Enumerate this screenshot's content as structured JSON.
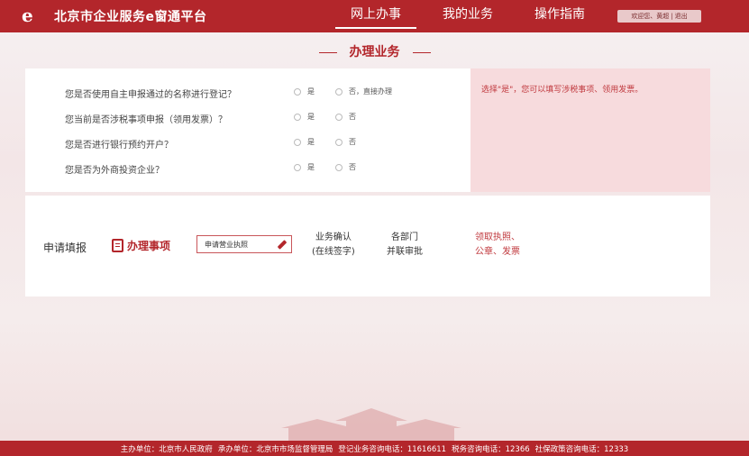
{
  "header": {
    "site_title": "北京市企业服务e窗通平台",
    "nav": [
      "网上办事",
      "我的业务",
      "操作指南"
    ],
    "user": {
      "welcome": "欢迎您、黄超",
      "sep": "|",
      "logout": "退出"
    }
  },
  "section_title": "办理业务",
  "questions": [
    {
      "text": "您是否使用自主申报通过的名称进行登记？",
      "opt_yes": "是",
      "opt_no": "否，直接办理"
    },
    {
      "text": "您当前是否涉税事项申报（领用发票）？",
      "opt_yes": "是",
      "opt_no": "否"
    },
    {
      "text": "您是否进行银行预约开户？",
      "opt_yes": "是",
      "opt_no": "否"
    },
    {
      "text": "您是否为外商投资企业？",
      "opt_yes": "是",
      "opt_no": "否"
    }
  ],
  "info_text": "选择\"是\"，您可以填写涉税事项、领用发票。",
  "process": {
    "label": "申请填报",
    "active_step": "办理事项",
    "apply_button": "申请营业执照",
    "step2": [
      "业务确认",
      "(在线签字)"
    ],
    "step3": [
      "各部门",
      "并联审批"
    ],
    "step4": [
      "领取执照、",
      "公章、发票"
    ]
  },
  "footer": {
    "host": "主办单位：北京市人民政府",
    "organizer": "承办单位：北京市市场监督管理局",
    "reg_phone": "登记业务咨询电话：11616611",
    "tax_phone": "税务咨询电话：12366",
    "social_phone": "社保政策咨询电话：12333"
  }
}
